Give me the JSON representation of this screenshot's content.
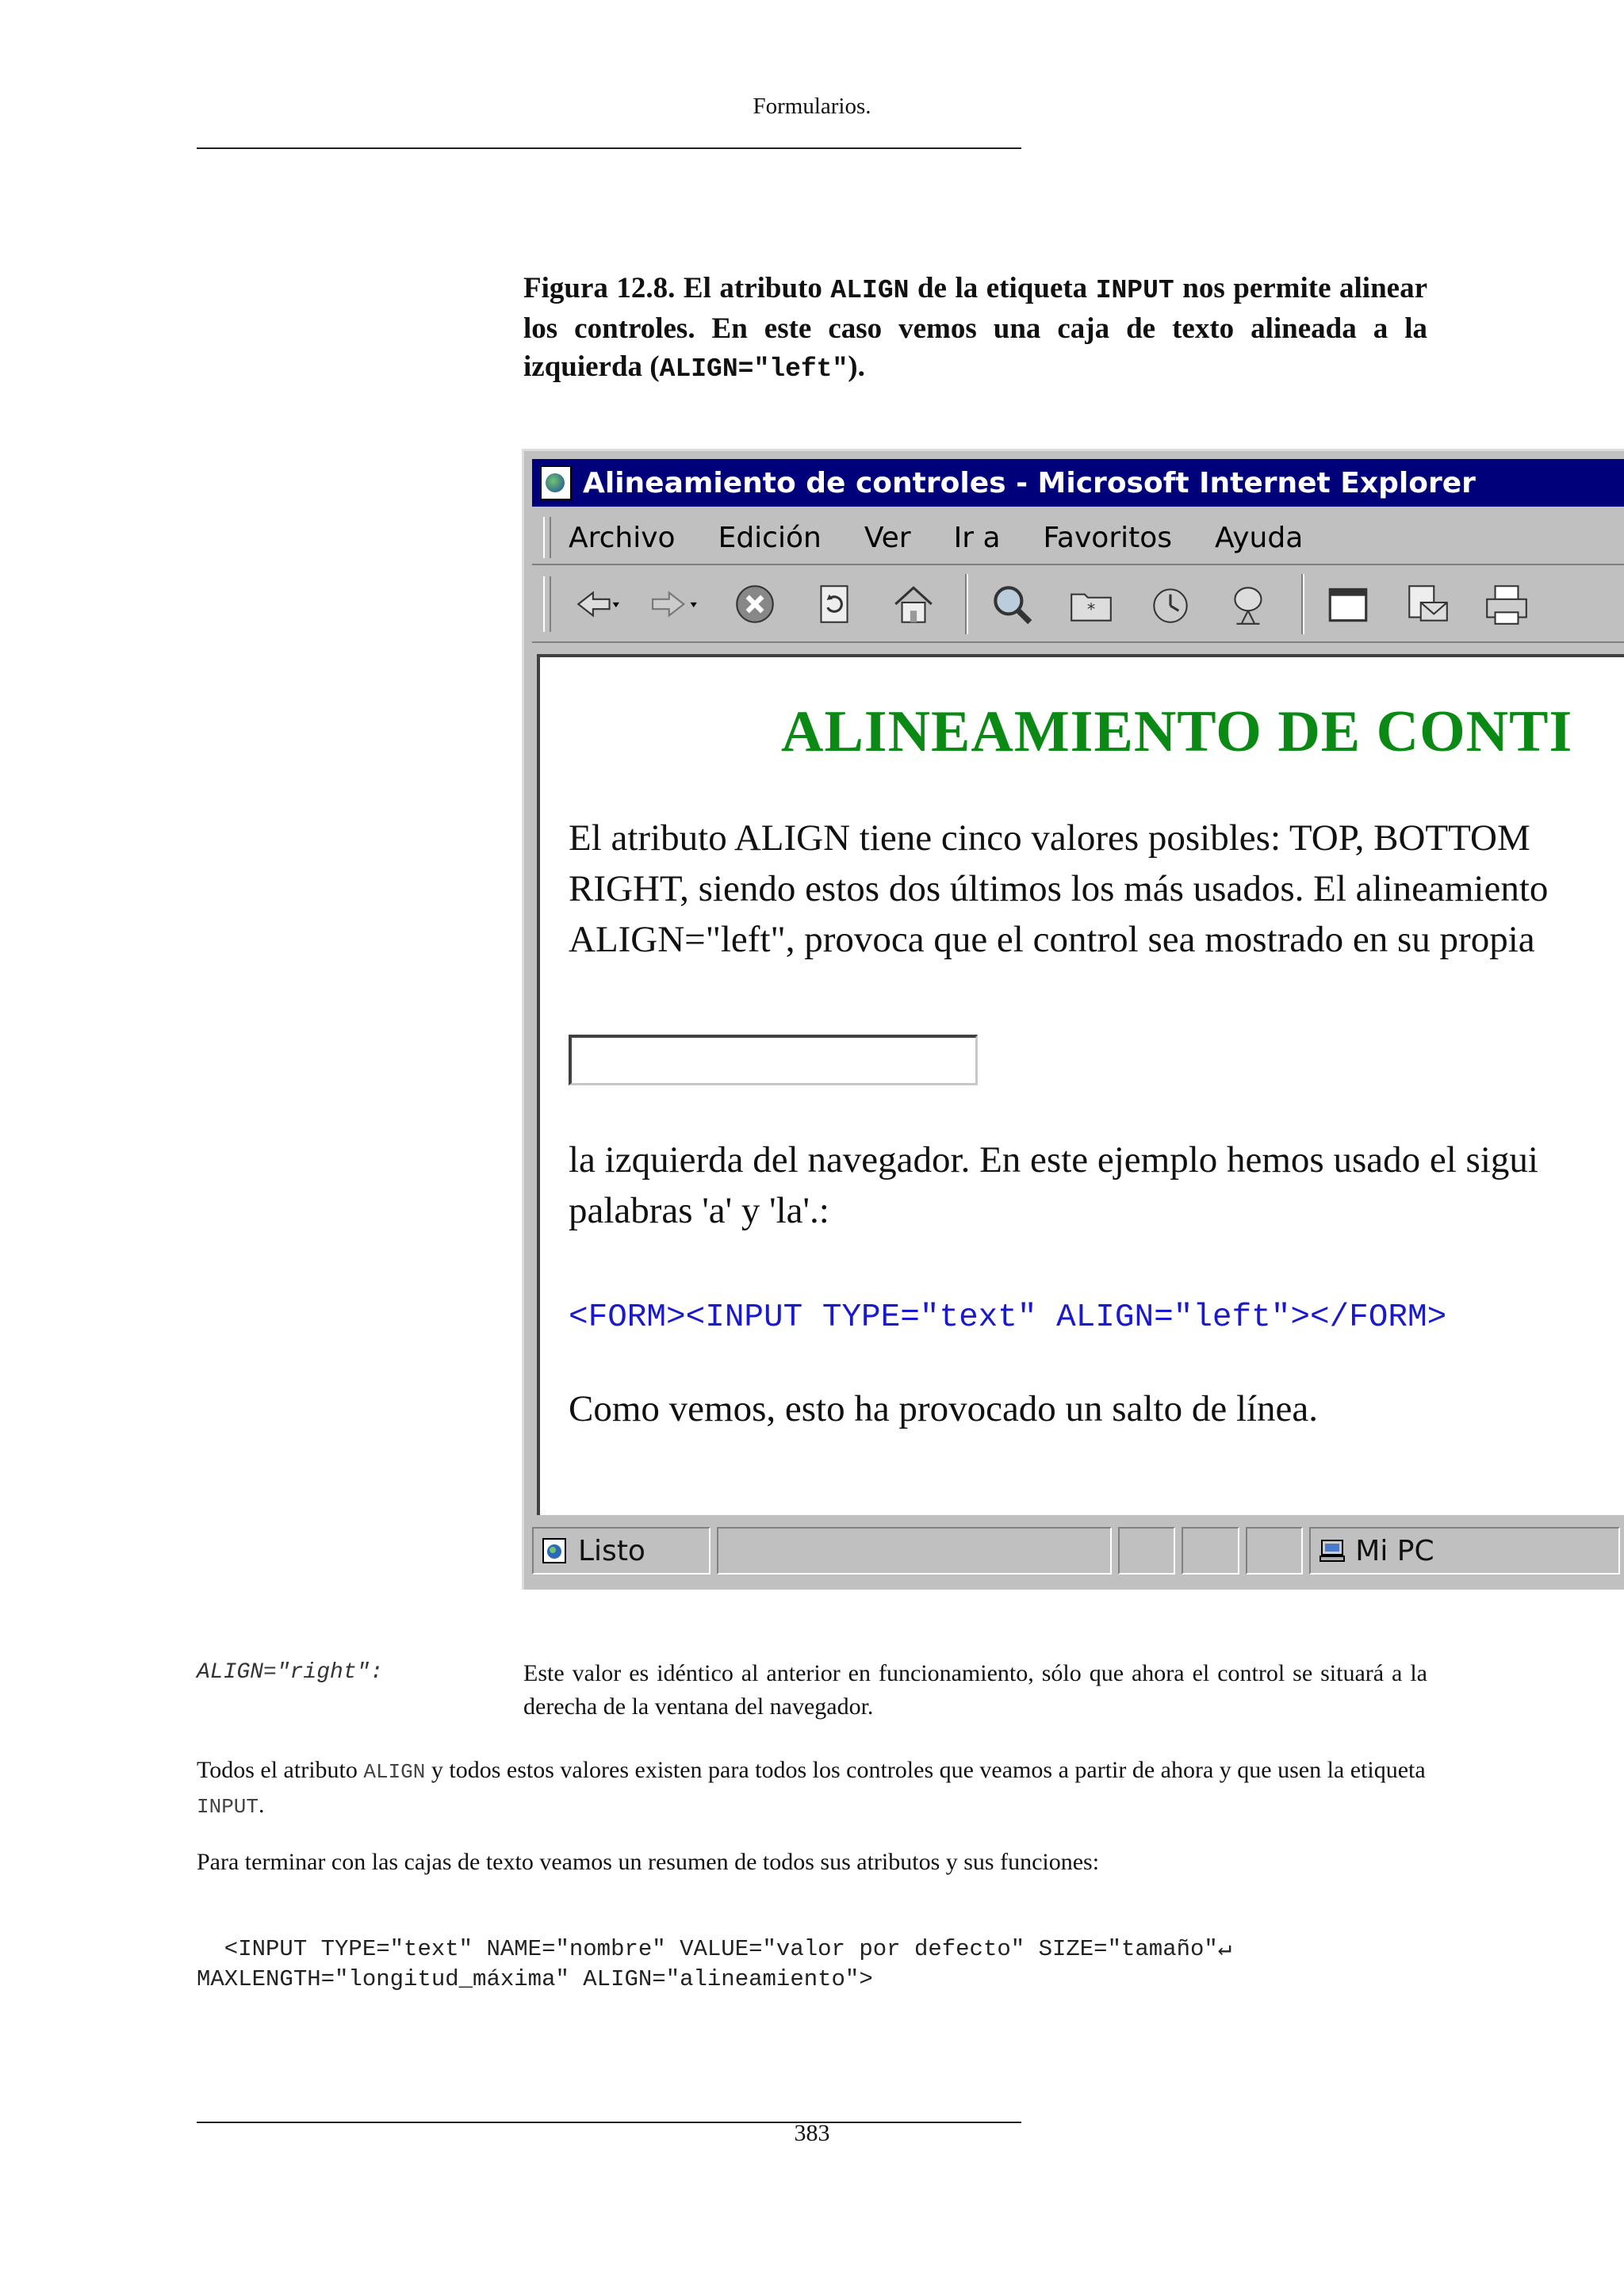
{
  "header": {
    "title": "Formularios."
  },
  "caption": {
    "part1": "Figura 12.8. El atributo ",
    "code1": "ALIGN",
    "part2": " de la etiqueta ",
    "code2": "INPUT",
    "part3": " nos permite alinear los controles. En este caso vemos una caja de texto alineada a la izquierda (",
    "code3": "ALIGN=\"left\"",
    "part4": ")."
  },
  "browser": {
    "title": "Alineamiento de controles - Microsoft Internet Explorer",
    "menu": [
      "Archivo",
      "Edición",
      "Ver",
      "Ir a",
      "Favoritos",
      "Ayuda"
    ],
    "toolbar_icons": [
      "back-icon",
      "forward-icon",
      "stop-icon",
      "refresh-icon",
      "home-icon",
      "search-icon",
      "favorites-icon",
      "history-icon",
      "channels-icon",
      "fullscreen-icon",
      "mail-icon",
      "print-icon"
    ],
    "page_heading": "ALINEAMIENTO DE CONTI",
    "para_lines": [
      "El atributo ALIGN tiene cinco valores posibles: TOP, BOTTOM",
      "RIGHT, siendo estos dos últimos los más usados. El alineamiento",
      "ALIGN=\"left\", provoca que el control sea mostrado en su propia"
    ],
    "para2_lines": [
      "la izquierda del navegador. En este ejemplo hemos usado el sigui",
      "palabras 'a' y 'la'.:"
    ],
    "code_line": "<FORM><INPUT TYPE=\"text\" ALIGN=\"left\"></FORM>",
    "closing_line": "Como vemos, esto ha provocado un salto de línea.",
    "status": {
      "text": "Listo",
      "zone": "Mi PC"
    }
  },
  "definition": {
    "term": "ALIGN=\"right\":",
    "text": "Este valor es idéntico al anterior en funcionamiento, sólo que ahora el control se situará a la derecha de la ventana del navegador."
  },
  "paragraph1": {
    "a": "Todos el atributo ",
    "code1": "ALIGN",
    "b": " y todos estos valores existen para todos los controles que veamos a partir de ahora y que usen la etiqueta ",
    "code2": "INPUT",
    "c": "."
  },
  "paragraph2": "Para terminar con las cajas de texto veamos un resumen de todos sus atributos y sus funciones:",
  "code_block": {
    "line1": "  <INPUT TYPE=\"text\" NAME=\"nombre\" VALUE=\"valor por defecto\" SIZE=\"tamaño\"↵",
    "line2": "MAXLENGTH=\"longitud_máxima\" ALIGN=\"alineamiento\">"
  },
  "footer": {
    "page_number": "383"
  }
}
